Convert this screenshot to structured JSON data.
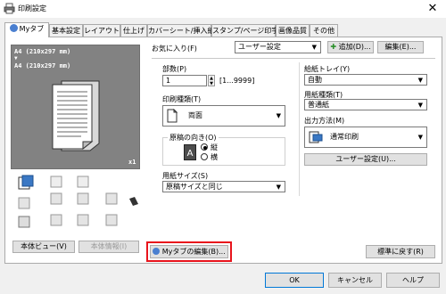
{
  "window": {
    "title": "印刷設定",
    "close_glyph": "✕"
  },
  "tabs": [
    {
      "label": "Myタブ",
      "active": true
    },
    {
      "label": "基本設定"
    },
    {
      "label": "レイアウト"
    },
    {
      "label": "仕上げ"
    },
    {
      "label": "カバーシート/挿入紙"
    },
    {
      "label": "スタンプ/ページ印字"
    },
    {
      "label": "画像品質"
    },
    {
      "label": "その他"
    }
  ],
  "favorites": {
    "label": "お気に入り(F)",
    "value": "ユーザー設定",
    "add_button": "追加(D)...",
    "edit_button": "編集(E)..."
  },
  "preview": {
    "line1": "A4 (210x297 mm)",
    "arrow": "▼",
    "line2": "A4 (210x297 mm)",
    "copies_badge": "x1"
  },
  "side_buttons": {
    "printer_view": "本体ビュー(V)",
    "printer_info": "本体情報(I)"
  },
  "copies": {
    "label": "部数(P)",
    "value": "1",
    "range": "[1...9999]"
  },
  "print_type": {
    "label": "印刷種類(T)",
    "value": "両面"
  },
  "orientation": {
    "label": "原稿の向き(O)",
    "portrait": "縦",
    "landscape": "横",
    "selected": "portrait"
  },
  "paper_size": {
    "label": "用紙サイズ(S)",
    "value": "原稿サイズと同じ"
  },
  "paper_tray": {
    "label": "給紙トレイ(Y)",
    "value": "自動"
  },
  "paper_type": {
    "label": "用紙種類(T)",
    "value": "普通紙"
  },
  "output_method": {
    "label": "出力方法(M)",
    "value": "通常印刷",
    "user_settings_button": "ユーザー設定(U)..."
  },
  "my_tab_edit": {
    "label": "Myタブの編集(B)..."
  },
  "restore_default": {
    "label": "標準に戻す(R)"
  },
  "footer": {
    "ok": "OK",
    "cancel": "キャンセル",
    "help": "ヘルプ"
  },
  "colors": {
    "highlight": "#e8141c",
    "accent": "#0078d7"
  }
}
